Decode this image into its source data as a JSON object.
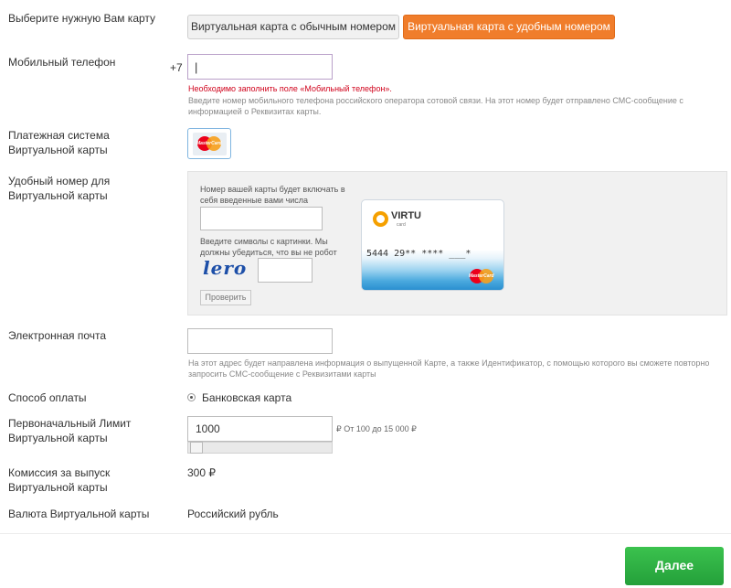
{
  "card_choice": {
    "label": "Выберите нужную Вам карту",
    "option_regular": "Виртуальная карта с обычным номером",
    "option_convenient": "Виртуальная карта с удобным номером",
    "active_color": "#f07d2b"
  },
  "phone": {
    "label": "Мобильный телефон",
    "prefix": "+7",
    "value": "|",
    "error": "Необходимо заполнить поле «Мобильный телефон».",
    "hint": "Введите номер мобильного телефона российского оператора сотовой связи. На этот номер будет отправлено СМС-сообщение с информацией о Реквизитах карты.",
    "error_color": "#d0021b"
  },
  "payment_system": {
    "label": "Платежная система Виртуальной карты",
    "logo_text": "MasterCard",
    "icon": "mastercard-icon"
  },
  "number": {
    "label": "Удобный номер для Виртуальной карты",
    "instruction": "Номер вашей карты будет включать в себя введенные вами числа",
    "value": "",
    "captcha_instruction": "Введите символы с картинки. Мы должны убедиться, что вы не робот",
    "captcha_text": "lero",
    "captcha_value": "",
    "check_button": "Проверить",
    "card_brand": "VIRTU",
    "card_brand_sub": "card",
    "card_number": "5444 29** **** ___*",
    "card_logo": "MasterCard"
  },
  "email": {
    "label": "Электронная почта",
    "value": "",
    "hint": "На этот адрес будет направлена информация о выпущенной Карте, а также Идентификатор, с помощью которого вы сможете повторно запросить СМС-сообщение с Реквизитами карты"
  },
  "payment_method": {
    "label": "Способ оплаты",
    "option": "Банковская карта"
  },
  "limit": {
    "label": "Первоначальный Лимит Виртуальной карты",
    "value": "1000",
    "range_text": "₽ От 100 до 15 000 ₽",
    "slider_level": 0.0
  },
  "commission": {
    "label": "Комиссия за выпуск Виртуальной карты",
    "value": "300 ₽"
  },
  "currency": {
    "label": "Валюта Виртуальной карты",
    "value": "Российский рубль"
  },
  "next_button": "Далее",
  "next_color": "#24a03a"
}
